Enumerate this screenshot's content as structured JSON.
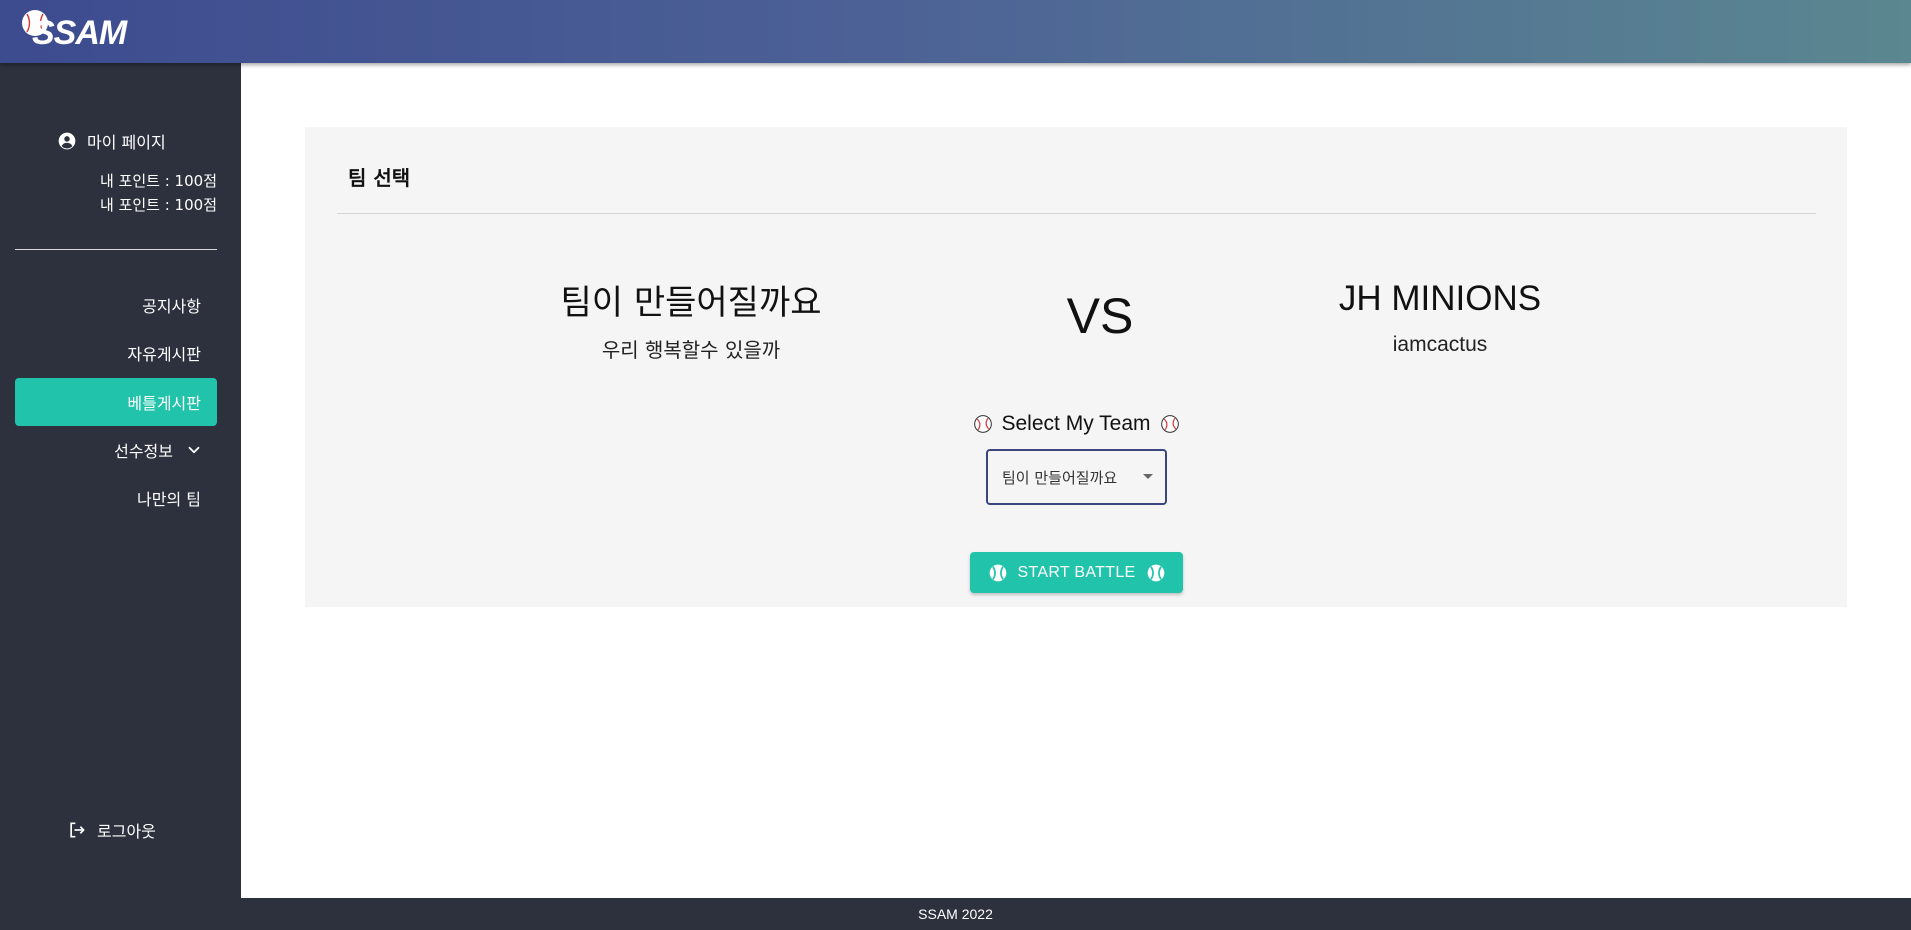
{
  "header": {
    "logo_text": "SSAM"
  },
  "sidebar": {
    "mypage_label": "마이 페이지",
    "points": [
      "내 포인트 : 100점",
      "내 포인트 : 100점"
    ],
    "items": [
      {
        "label": "공지사항",
        "active": false
      },
      {
        "label": "자유게시판",
        "active": false
      },
      {
        "label": "베틀게시판",
        "active": true
      },
      {
        "label": "선수정보",
        "active": false,
        "expandable": true
      },
      {
        "label": "나만의 팀",
        "active": false
      }
    ],
    "logout_label": "로그아웃"
  },
  "card": {
    "title": "팀 선택",
    "left_team": {
      "name": "팀이 만들어질까요",
      "subtitle": "우리 행복할수 있을까"
    },
    "vs_label": "VS",
    "right_team": {
      "name": "JH MINIONS",
      "subtitle": "iamcactus"
    },
    "select_label": "Select My Team",
    "selected_team": "팀이 만들어질까요",
    "start_button_label": "START BATTLE"
  },
  "footer": {
    "text": "SSAM 2022"
  },
  "colors": {
    "accent": "#21c4ab",
    "sidebar_bg": "#2c313d",
    "header_start": "#3d4b8f",
    "header_end": "#5a8790",
    "card_bg": "#f5f5f5"
  },
  "icons": {
    "logo": "baseball-icon",
    "mypage": "account-circle-icon",
    "chevron": "chevron-down-icon",
    "logout": "logout-icon",
    "select_label": "baseball-icon",
    "start_button": "tennis-ball-icon"
  }
}
